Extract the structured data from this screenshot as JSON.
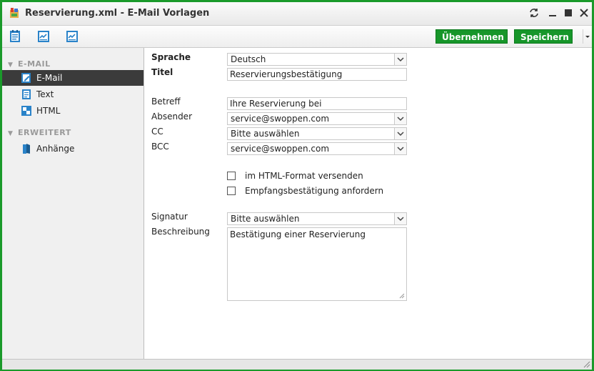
{
  "window": {
    "title": "Reservierung.xml - E-Mail Vorlagen",
    "accent": "#1a9a2a"
  },
  "toolbar": {
    "icons": [
      "text-document-icon",
      "chart-icon",
      "chart-icon"
    ],
    "apply_label": "Übernehmen",
    "save_label": "Speichern"
  },
  "sidebar": {
    "section_email": "E-MAIL",
    "section_extended": "ERWEITERT",
    "items": [
      {
        "label": "E-Mail",
        "icon": "email-edit-icon",
        "active": true
      },
      {
        "label": "Text",
        "icon": "text-document-icon",
        "active": false
      },
      {
        "label": "HTML",
        "icon": "html-checker-icon",
        "active": false
      },
      {
        "label": "Anhänge",
        "icon": "attachment-book-icon",
        "active": false
      }
    ]
  },
  "form": {
    "language_label": "Sprache",
    "language_value": "Deutsch",
    "title_label": "Titel",
    "title_value": "Reservierungsbestätigung",
    "subject_label": "Betreff",
    "subject_value": "Ihre Reservierung bei",
    "sender_label": "Absender",
    "sender_value": "service@swoppen.com",
    "cc_label": "CC",
    "cc_value": "Bitte auswählen",
    "bcc_label": "BCC",
    "bcc_value": "service@swoppen.com",
    "html_format_label": "im HTML-Format versenden",
    "html_format_checked": false,
    "receipt_label": "Empfangsbestätigung anfordern",
    "receipt_checked": false,
    "signature_label": "Signatur",
    "signature_value": "Bitte auswählen",
    "description_label": "Beschreibung",
    "description_value": "Bestätigung einer Reservierung"
  }
}
